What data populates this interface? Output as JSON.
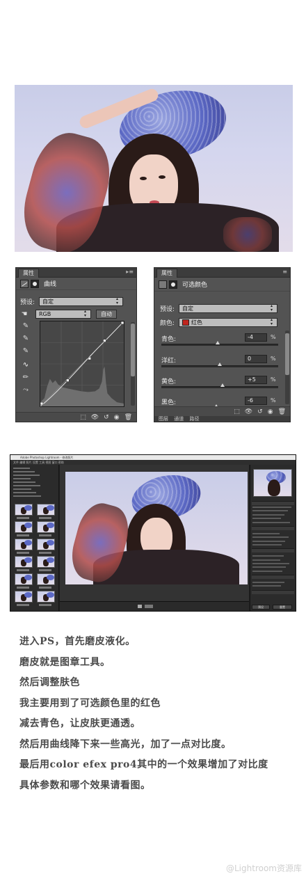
{
  "curves_panel": {
    "tab": "属性",
    "title": "曲线",
    "preset_label": "预设:",
    "preset_value": "自定",
    "channel_value": "RGB",
    "auto_button": "自动"
  },
  "selective_color_panel": {
    "tab": "属性",
    "title": "可选颜色",
    "preset_label": "预设:",
    "preset_value": "自定",
    "colors_label": "颜色:",
    "colors_value": "红色",
    "colors_swatch": "#c0261f",
    "sliders": [
      {
        "label": "青色:",
        "value": "-4",
        "unit": "%",
        "level": -4
      },
      {
        "label": "洋红:",
        "value": "0",
        "unit": "%",
        "level": 0
      },
      {
        "label": "黄色:",
        "value": "+5",
        "unit": "%",
        "level": 5
      },
      {
        "label": "黑色:",
        "value": "-6",
        "unit": "%",
        "level": -6
      }
    ],
    "bottom_tabs": [
      "图层",
      "通道",
      "路径"
    ]
  },
  "lightroom": {
    "title_text": "Adobe Photoshop Lightroom - 修改照片",
    "menu_text": "文件  编辑  照片  设置  工具  视图  窗口  帮助",
    "buttons": [
      "预设",
      "重置"
    ]
  },
  "article_lines": [
    "进入PS，首先磨皮液化。",
    "磨皮就是图章工具。",
    "然后调整肤色",
    "我主要用到了可选颜色里的红色",
    "减去青色，让皮肤更通透。",
    "然后用曲线降下来一些高光，加了一点对比度。",
    "最后用color efex pro4其中的一个效果增加了对比度",
    "具体参数和哪个效果请看图。"
  ],
  "watermark": "@Lightroom资源库"
}
